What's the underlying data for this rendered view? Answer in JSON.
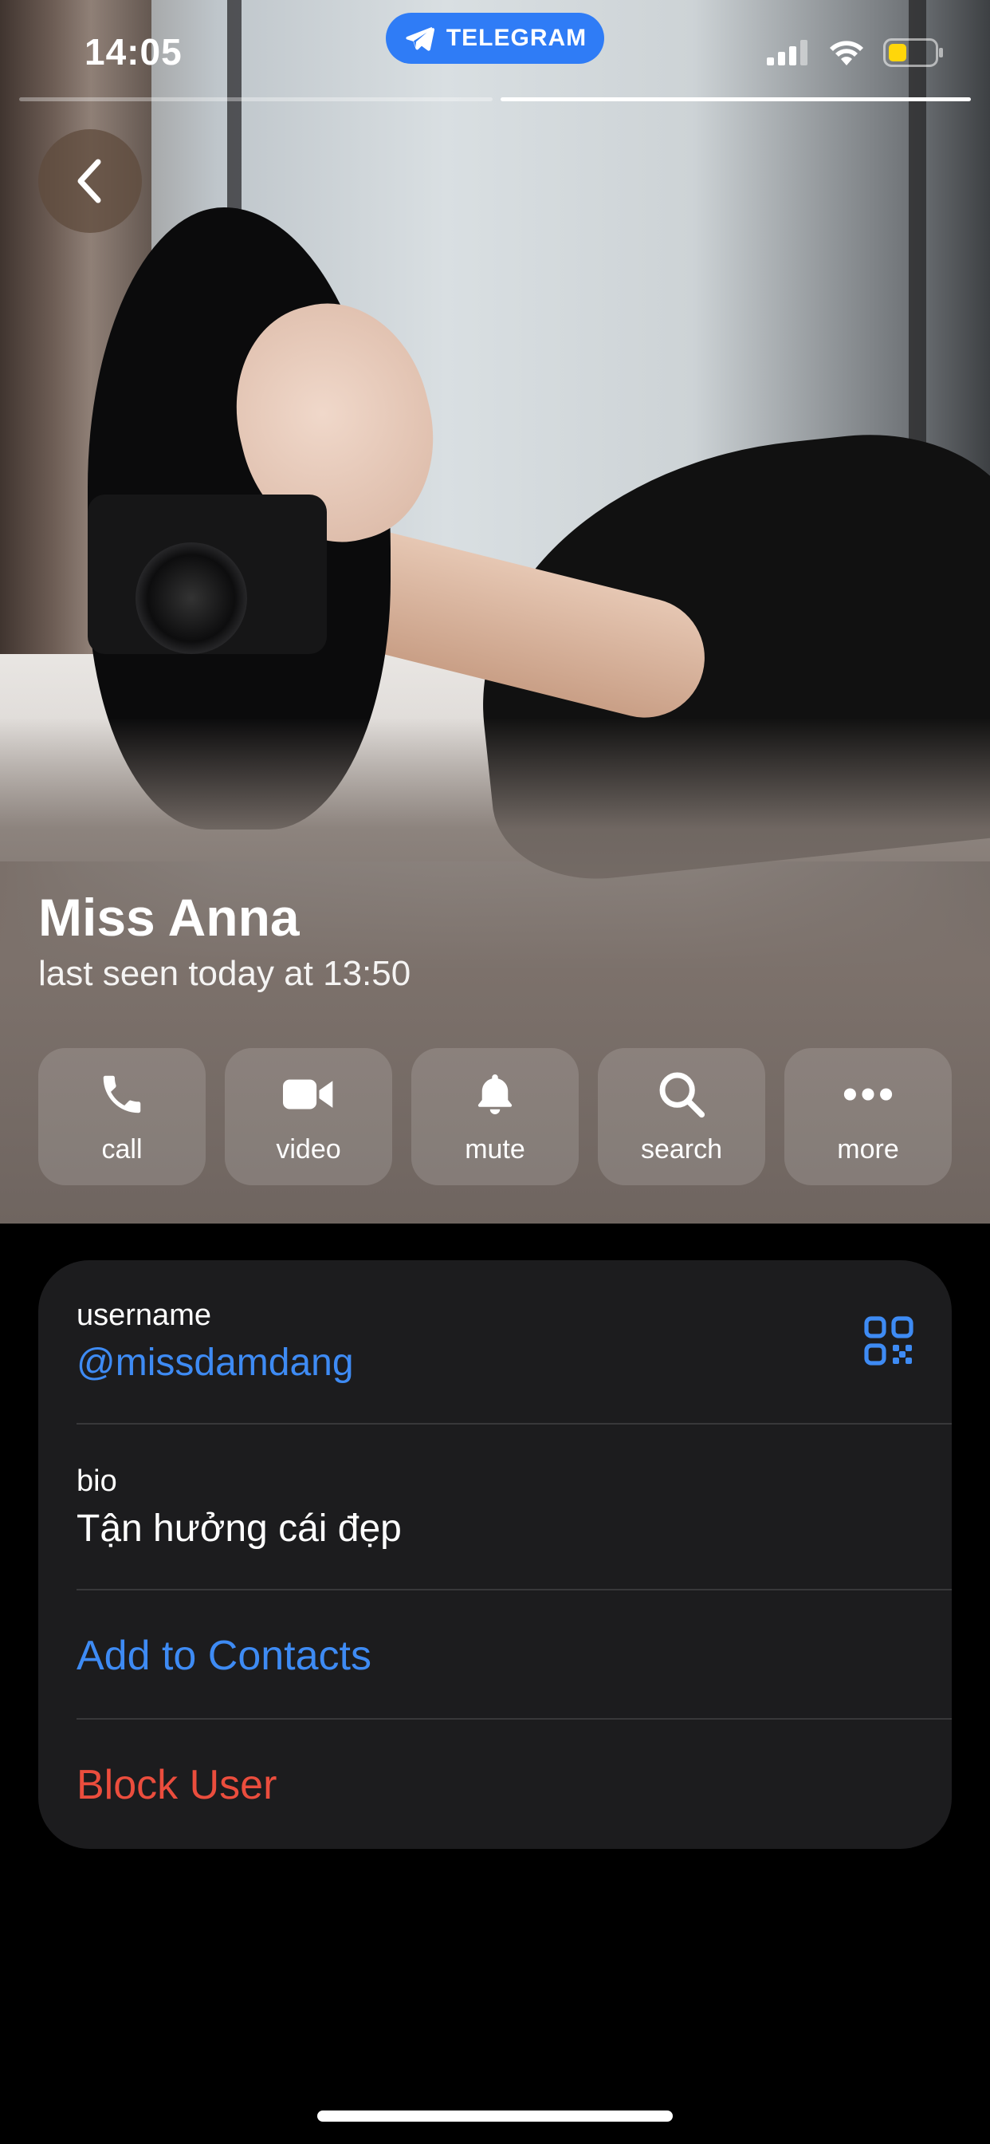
{
  "status_bar": {
    "time": "14:05",
    "app_pill": "TELEGRAM",
    "icons": [
      "signal-icon",
      "wifi-icon",
      "battery-icon"
    ]
  },
  "story_progress": {
    "segments": 2,
    "active_segment": 2
  },
  "profile": {
    "name": "Miss Anna",
    "status": "last seen today at 13:50"
  },
  "actions": [
    {
      "label": "call",
      "icon": "phone-icon"
    },
    {
      "label": "video",
      "icon": "video-camera-icon"
    },
    {
      "label": "mute",
      "icon": "bell-icon"
    },
    {
      "label": "search",
      "icon": "search-icon"
    },
    {
      "label": "more",
      "icon": "more-dots-icon"
    }
  ],
  "info": {
    "username_caption": "username",
    "username_value": "@missdamdang",
    "bio_caption": "bio",
    "bio_value": "Tận hưởng cái đẹp",
    "add_contact": "Add to Contacts",
    "block_user": "Block User"
  },
  "colors": {
    "accent_blue": "#3e8bf4",
    "destructive_red": "#eb4d3d",
    "card_bg": "#1c1c1e",
    "telegram_pill": "#2f7cf6"
  }
}
